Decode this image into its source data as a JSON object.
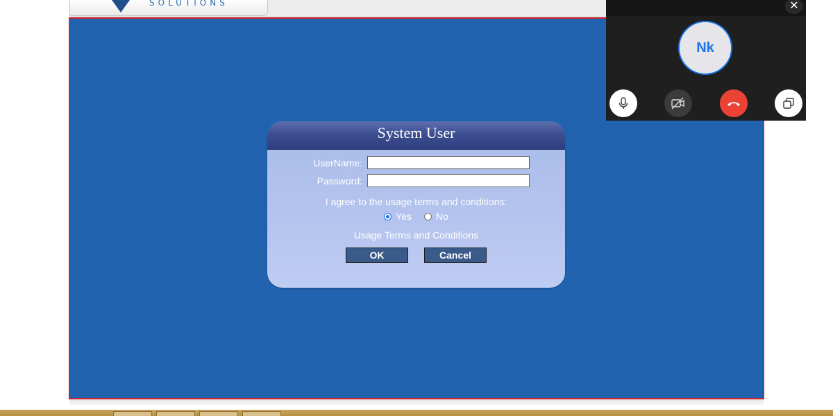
{
  "header": {
    "brand": "SOLUTIONS"
  },
  "dialog": {
    "title": "System User",
    "username_label": "UserName:",
    "username_value": "",
    "password_label": "Password:",
    "password_value": "",
    "agree_text": "I agree to the usage terms and conditions:",
    "yes_label": "Yes",
    "no_label": "No",
    "selected": "Yes",
    "terms_link": "Usage Terms and Conditions",
    "ok_label": "OK",
    "cancel_label": "Cancel"
  },
  "call": {
    "avatar_initials": "Nk",
    "close_label": "✕",
    "buttons": [
      "microphone-icon",
      "camera-off-icon",
      "hang-up-icon",
      "popout-icon"
    ],
    "colors": {
      "accent": "#1a73e8",
      "hangup": "#ea4335"
    }
  },
  "colors": {
    "app_background": "#2163ae",
    "frame_border": "#d0202a",
    "button": "#3a5a8a"
  }
}
